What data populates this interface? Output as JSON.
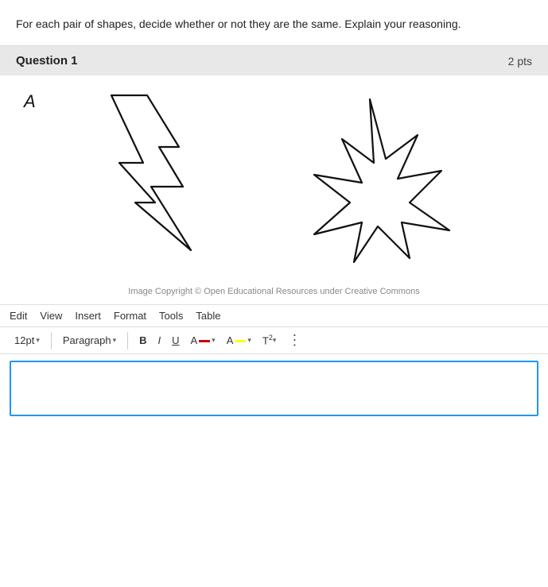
{
  "intro": {
    "text": "For each pair of shapes, decide whether or not they are the same. Explain your reasoning."
  },
  "question": {
    "title": "Question 1",
    "pts": "2 pts"
  },
  "shapes_label": "A",
  "copyright": "Image Copyright © Open Educational Resources under Creative Commons",
  "menubar": {
    "items": [
      "Edit",
      "View",
      "Insert",
      "Format",
      "Tools",
      "Table"
    ]
  },
  "toolbar": {
    "font_size": "12pt",
    "paragraph": "Paragraph",
    "bold_label": "B",
    "italic_label": "I",
    "underline_label": "U",
    "font_color": "#000000",
    "highlight_color": "#ffff00",
    "superscript_label": "T²",
    "more_label": "⋮"
  }
}
